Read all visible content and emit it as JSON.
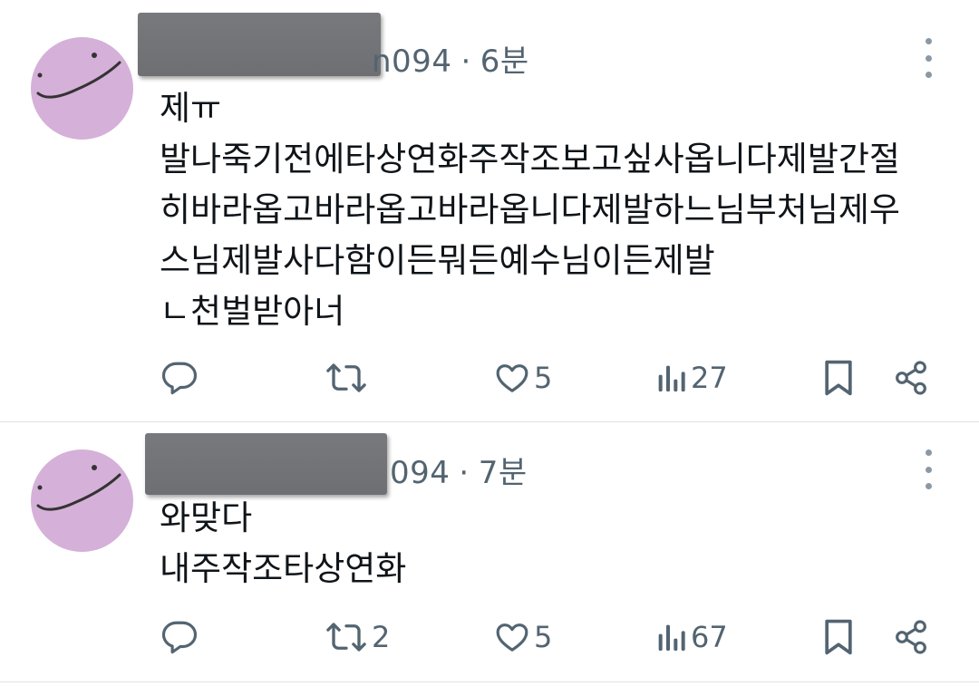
{
  "posts": [
    {
      "handle_suffix": "n094",
      "separator": "·",
      "time": "6분",
      "lines": [
        "제ㅠ",
        "발나죽기전에타상연화주작조보고싶사옵니다제발간절",
        "히바라옵고바라옵고바라옵니다제발하느님부처님제우",
        "스님제발사다함이든뭐든예수님이든제발",
        "ㄴ천벌받아너"
      ],
      "retweets": "",
      "likes": "5",
      "views": "27"
    },
    {
      "handle_suffix": "094",
      "separator": "·",
      "time": "7분",
      "lines": [
        "와맞다",
        "내주작조타상연화"
      ],
      "retweets": "2",
      "likes": "5",
      "views": "67"
    }
  ],
  "icons": {
    "reply": "reply-icon",
    "retweet": "retweet-icon",
    "like": "heart-icon",
    "views": "views-icon",
    "bookmark": "bookmark-icon",
    "share": "share-icon",
    "more": "more-icon"
  },
  "colors": {
    "avatar": "#d5b0d8",
    "secondary_text": "#536471",
    "redaction": "#727478",
    "divider": "#dfe3e6"
  }
}
